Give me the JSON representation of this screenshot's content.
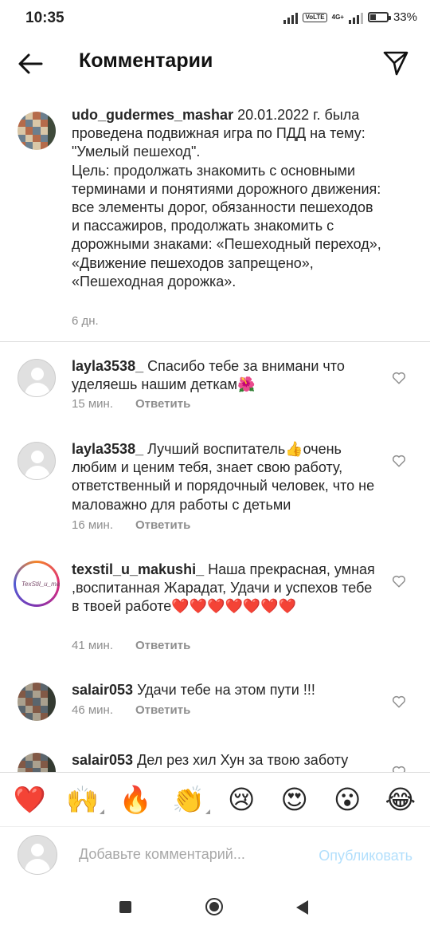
{
  "status": {
    "time": "10:35",
    "network": "4G+",
    "volte": "VoLTE",
    "battery_percent": "33%",
    "battery_level": 0.33
  },
  "header": {
    "title": "Комментарии"
  },
  "caption": {
    "username": "udo_gudermes_mashar",
    "text": " 20.01.2022 г. была проведена подвижная игра по ПДД на тему: \"Умелый пешеход\".\nЦель: продолжать знакомить с основными терминами и понятиями дорожного движения: все элементы дорог, обязанности пешеходов и пассажиров, продолжать знакомить с дорожными знаками: «Пешеходный переход», «Движение пешеходов запрещено», «Пешеходная дорожка».",
    "time": "6 дн."
  },
  "comments": [
    {
      "username": "layla3538_",
      "text": " Спасибо тебе за внимани что уделяешь нашим деткам🌺",
      "time": "15 мин.",
      "reply": "Ответить"
    },
    {
      "username": "layla3538_",
      "text": " Лучший воспитатель👍очень любим и ценим тебя, знает свою работу, ответственный и порядочный человек, что не маловажно для работы с детьми",
      "time": "16 мин.",
      "reply": "Ответить"
    },
    {
      "username": "texstil_u_makushi_",
      "text": " Наша прекрасная, умная ,воспитанная Жарадат,  Удачи и успехов тебе в твоей работе❤️❤️❤️❤️❤️❤️❤️",
      "time": "41 мин.",
      "reply": "Ответить",
      "avatar_logo": "TexStil_u_makushi"
    },
    {
      "username": "salair053",
      "text": " Удачи тебе на этом пути !!!",
      "time": "46 мин.",
      "reply": "Ответить"
    },
    {
      "username": "salair053",
      "text": " Дел рез хил Хун за твою заботу",
      "time": "",
      "reply": ""
    }
  ],
  "emojis": [
    "❤️",
    "🙌",
    "🔥",
    "👏",
    "😢",
    "😍",
    "😮",
    "😂"
  ],
  "compose": {
    "placeholder": "Добавьте комментарий...",
    "publish": "Опубликовать"
  },
  "icons": {
    "back": "arrow-left-icon",
    "send": "paper-plane-icon",
    "like": "heart-outline-icon"
  }
}
